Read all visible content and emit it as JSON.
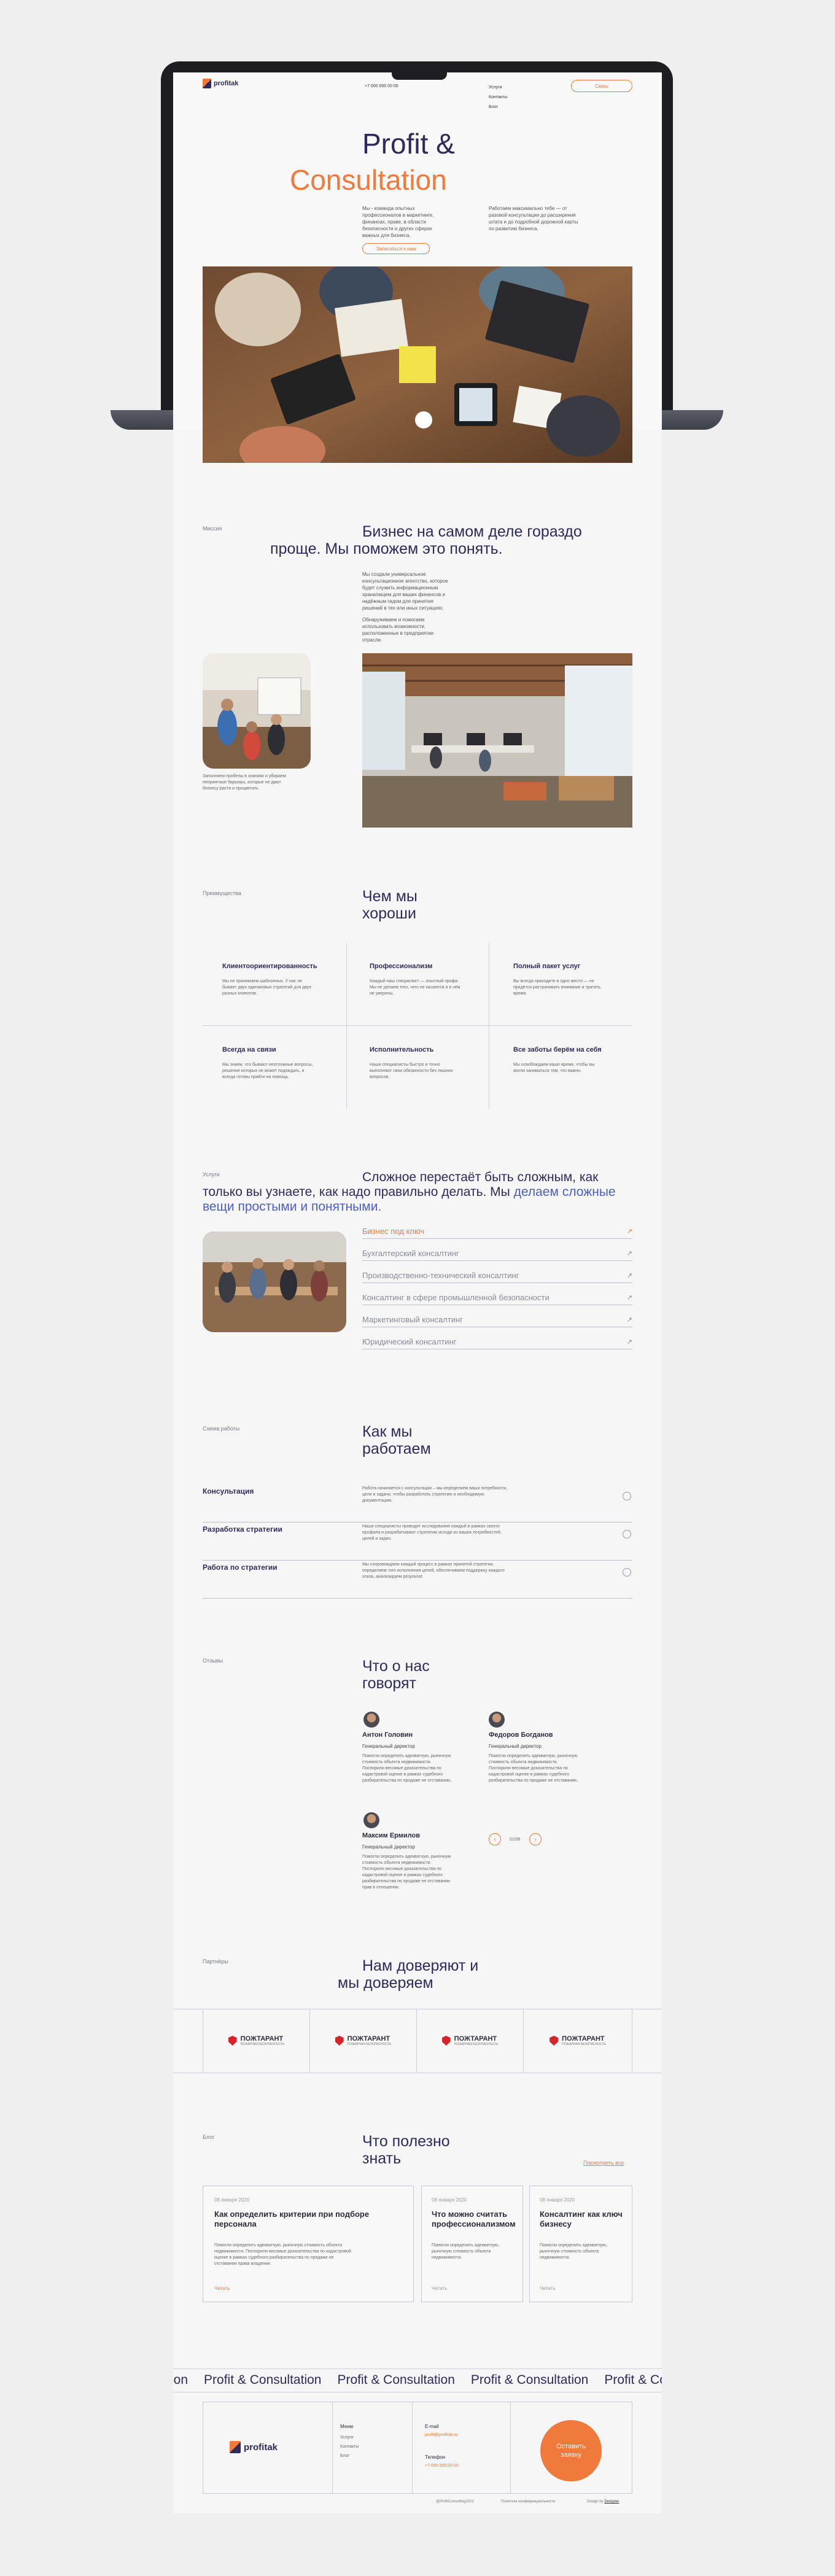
{
  "header": {
    "logo_text": "profitak",
    "phone": "+7 000 000 00 00",
    "nav": [
      "Услуги",
      "Контакты",
      "Блог"
    ],
    "cta": "Связь"
  },
  "hero": {
    "title_line1": "Profit &",
    "title_line2": "Consultation",
    "text_left": "Мы - команда опытных профессионалов в маркетинге, финансах, праве, в области безопасности и других сферах важных для бизнеса.",
    "text_right": "Работаем максимально тебе — от разовой консультации до расширения штата и до подробной дорожной карты по развитию бизнеса.",
    "button": "Записаться к нам"
  },
  "mission": {
    "label": "Миссия",
    "title_line1": "Бизнес на самом деле гораздо",
    "title_line2": "проще. Мы поможем это понять.",
    "para1": "Мы создали универсальное консультационное агентство, которое будет служить информационным хранилищем для ваших финансов и надёжным гидом для принятия решений в тех или иных ситуациях.",
    "para2": "Обнаруживаем и помогаем использовать возможности, расположенные в предприятии отрасли.",
    "caption": "Заполняем пробелы в знаниях и убираем неприятные барьеры, которые не дают бизнесу расти и процветать."
  },
  "advantages": {
    "label": "Преимущества",
    "title_line1": "Чем мы",
    "title_line2": "хороши",
    "items": [
      {
        "title": "Клиентоориентированность",
        "text": "Мы не принимаем шаблонных. У нас не бывает двух одинаковых стратегий для двух разных клиентов."
      },
      {
        "title": "Профессионализм",
        "text": "Каждый наш специалист — опытный профи. Мы не делаем того, чего не касаются и в чём не уверены."
      },
      {
        "title": "Полный пакет услуг",
        "text": "Вы всегда приходите в одно место — не придётся растрачивать внимание и тратить время."
      },
      {
        "title": "Всегда на связи",
        "text": "Мы знаем, что бывают неотложные вопросы, решение которых не может подождать, и всегда готовы прийти на помощь."
      },
      {
        "title": "Исполнительность",
        "text": "Наши специалисты быстро и точно выполняют свои обязанности без лишних вопросов."
      },
      {
        "title": "Все заботы берём на себя",
        "text": "Мы освобождаем ваше время, чтобы вы могли заниматься тем, что важно."
      }
    ]
  },
  "services": {
    "label": "Услуги",
    "title_line1": "Сложное перестаёт быть сложным, как",
    "title_line2a": "только вы узнаете, как надо правильно делать. Мы",
    "title_line2b": "делаем сложные",
    "title_line3": "вещи простыми и понятными.",
    "items": [
      "Бизнес под ключ",
      "Бухгалтерский консалтинг",
      "Производственно-технический консалтинг",
      "Консалтинг в сфере промышленной безопасности",
      "Маркетинговый консалтинг",
      "Юридический консалтинг"
    ]
  },
  "process": {
    "label": "Схема работы",
    "title_line1": "Как мы",
    "title_line2": "работаем",
    "steps": [
      {
        "title": "Консультация",
        "text": "Работа начинается с консультации – мы определяем ваши потребности, цели и задачи, чтобы разработать стратегию и необходимую документацию."
      },
      {
        "title": "Разработка стратегии",
        "text": "Наши специалисты проводят исследование каждый в рамках своего профиля и разрабатывают стратегию исходя из ваших потребностей, целей и задач."
      },
      {
        "title": "Работа по стратегии",
        "text": "Мы сопровождаем каждый процесс в рамках принятой стратегии, определяем того исполнения целей, обеспечиваем поддержку каждого этапа, анализируем результат."
      }
    ]
  },
  "reviews": {
    "label": "Отзывы",
    "title_line1": "Что о нас",
    "title_line2": "говорят",
    "items": [
      {
        "name": "Антон Головин",
        "role": "Генеральный директор",
        "text": "Помогли определить адекватную, рыночную стоимость объекта недвижимости. Поспорили весомые доказательства по кадастровой оценке в рамках судебного разбирательства по продаже не отставании.."
      },
      {
        "name": "Федоров Богданов",
        "role": "Генеральный директор",
        "text": "Помогли определить адекватную, рыночную стоимость объекта недвижимости. Поспорили весомые доказательства по кадастровой оценке в рамках судебного разбирательства по продаже не отставании.."
      },
      {
        "name": "Максим Ермилов",
        "role": "Генеральный директор",
        "text": "Помогли определить адекватную, рыночную стоимость объекта недвижимости. Поспорили весомые доказательства по кадастровой оценке в рамках судебного разбирательства по продаже не отставании прав в отношении."
      }
    ],
    "pager": "01/06"
  },
  "partners": {
    "label": "Партнёры",
    "title_line1": "Нам доверяют и",
    "title_line2": "мы доверяем",
    "logo_text": "ПОЖТАРАНТ",
    "logo_sub": "ПОЖАРНАЯ БЕЗОПАСНОСТЬ"
  },
  "blog": {
    "label": "Блог",
    "title_line1": "Что полезно",
    "title_line2": "знать",
    "all_link": "Посмотреть все",
    "cards": [
      {
        "date": "08 января 2020",
        "title": "Как определить критерии при подборе персонала",
        "text": "Помогли определить адекватную, рыночную стоимость объекта недвижимости. Поспорили весомые доказательства по кадастровой оценке в рамках судебного разбирательства по продаже не отставании права владения.",
        "link": "Читать"
      },
      {
        "date": "08 января 2020",
        "title": "Что можно считать профессионализмом",
        "text": "Помогли определить адекватную, рыночную стоимость объекта недвижимости.",
        "link": "Читать"
      },
      {
        "date": "08 января 2020",
        "title": "Консалтинг как ключ бизнесу",
        "text": "Помогли определить адекватную, рыночную стоимость объекта недвижимости.",
        "link": "Читать"
      }
    ]
  },
  "marquee": {
    "text": "Profit & Consultation",
    "partial_start": "ion",
    "partial_end": "Profit & Consu"
  },
  "footer": {
    "logo_text": "profitak",
    "menu_title": "Меню",
    "menu": [
      "Услуги",
      "Контакты",
      "Блог"
    ],
    "email_label": "E-mail",
    "email": "profit@profitak.ru",
    "phone_label": "Телефон",
    "phone": "+7 000 000 00 00",
    "cta": "Оставить заявку",
    "copyright": "@ProfitConsulting2022",
    "policy": "Политика конфиденциальности",
    "design_label": "Design by",
    "design_name": "Designer"
  }
}
